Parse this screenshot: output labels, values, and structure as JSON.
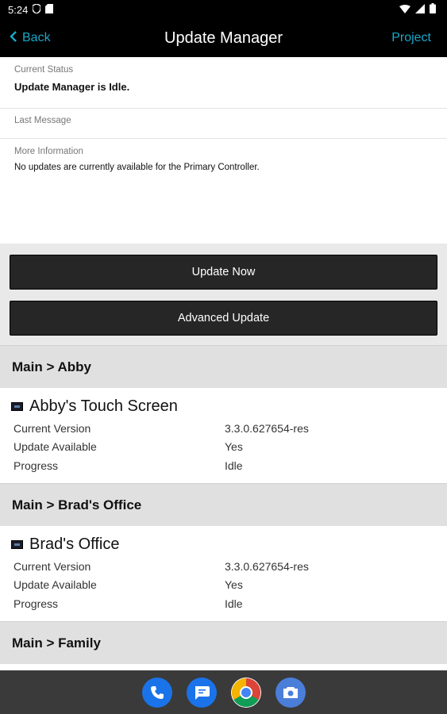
{
  "status_bar": {
    "time": "5:24"
  },
  "nav": {
    "back_label": "Back",
    "title": "Update Manager",
    "project_label": "Project"
  },
  "current_status": {
    "label": "Current Status",
    "value": "Update Manager is Idle."
  },
  "last_message": {
    "label": "Last Message",
    "value": ""
  },
  "more_info": {
    "label": "More Information",
    "value": "No updates are currently available for the Primary Controller."
  },
  "buttons": {
    "update_now": "Update Now",
    "advanced_update": "Advanced Update"
  },
  "sections": [
    {
      "header": "Main > Abby",
      "device": {
        "name": "Abby's Touch Screen",
        "rows": [
          {
            "key": "Current Version",
            "value": "3.3.0.627654-res"
          },
          {
            "key": "Update Available",
            "value": "Yes"
          },
          {
            "key": "Progress",
            "value": "Idle"
          }
        ]
      }
    },
    {
      "header": "Main > Brad's Office",
      "device": {
        "name": "Brad's Office",
        "rows": [
          {
            "key": "Current Version",
            "value": "3.3.0.627654-res"
          },
          {
            "key": "Update Available",
            "value": "Yes"
          },
          {
            "key": "Progress",
            "value": "Idle"
          }
        ]
      }
    },
    {
      "header": "Main > Family"
    }
  ],
  "dock": [
    "phone-app",
    "messages-app",
    "chrome-app",
    "camera-app"
  ],
  "colors": {
    "accent": "#1aa7c9",
    "nav_bg": "#000000",
    "button_bg": "#262626",
    "section_bg": "#e0e0e0"
  }
}
